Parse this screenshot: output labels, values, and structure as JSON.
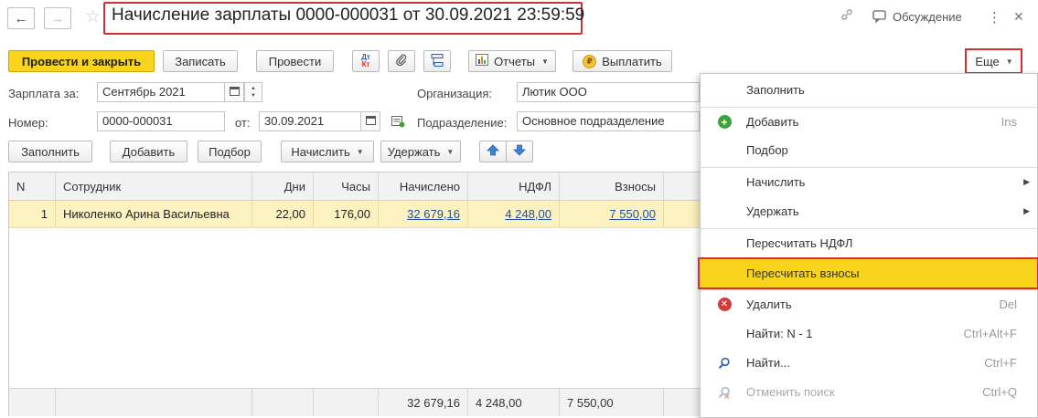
{
  "title": "Начисление зарплаты 0000-000031 от 30.09.2021 23:59:59",
  "header": {
    "back_icon": "←",
    "forward_icon": "→",
    "favorite_icon": "☆",
    "link_icon": "🔗",
    "discussion_label": "Обсуждение",
    "more_icon": "⋮",
    "close_icon": "✕"
  },
  "toolbar": {
    "post_close": "Провести и закрыть",
    "save": "Записать",
    "post": "Провести",
    "dtkt_top": "Дт",
    "dtkt_bottom": "Кт",
    "reports": "Отчеты",
    "pay": "Выплатить",
    "more": "Еще"
  },
  "form": {
    "salary_for_label": "Зарплата за:",
    "salary_for_value": "Сентябрь 2021",
    "org_label": "Организация:",
    "org_value": "Лютик ООО",
    "number_label": "Номер:",
    "number_value": "0000-000031",
    "date_label": "от:",
    "date_value": "30.09.2021",
    "division_label": "Подразделение:",
    "division_value": "Основное подразделение"
  },
  "table_toolbar": {
    "fill": "Заполнить",
    "add": "Добавить",
    "select": "Подбор",
    "accrue": "Начислить",
    "withhold": "Удержать"
  },
  "table": {
    "headers": [
      "N",
      "Сотрудник",
      "Дни",
      "Часы",
      "Начислено",
      "НДФЛ",
      "Взносы"
    ],
    "rows": [
      [
        "1",
        "Николенко Арина Васильевна",
        "22,00",
        "176,00",
        "32 679,16",
        "4 248,00",
        "7 550,00"
      ]
    ],
    "totals": [
      "32 679,16",
      "4 248,00",
      "7 550,00"
    ]
  },
  "menu": {
    "fill": "Заполнить",
    "add": "Добавить",
    "add_hotkey": "Ins",
    "select": "Подбор",
    "accrue": "Начислить",
    "withhold": "Удержать",
    "recalc_ndfl": "Пересчитать НДФЛ",
    "recalc_contrib": "Пересчитать взносы",
    "delete": "Удалить",
    "delete_hotkey": "Del",
    "find_n": "Найти: N - 1",
    "find_n_hotkey": "Ctrl+Alt+F",
    "find": "Найти...",
    "find_hotkey": "Ctrl+F",
    "cancel_search": "Отменить поиск",
    "cancel_search_hotkey": "Ctrl+Q"
  },
  "colors": {
    "accent": "#f7d31b",
    "highlight_border": "#d32f2f",
    "row_selected": "#fcf1bf",
    "link": "#1c4f9e"
  }
}
